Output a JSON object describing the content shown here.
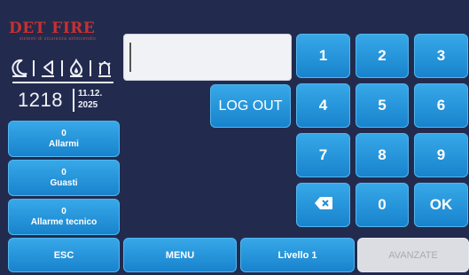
{
  "logo": {
    "brand": "DET FIRE",
    "tagline": "sistemi di sicurezza antincendio"
  },
  "status_icons": [
    "moon-icon",
    "speaker-icon",
    "flame-icon",
    "siren-icon"
  ],
  "clock": {
    "time": "1218",
    "date_line1": "11.12.",
    "date_line2": "2025"
  },
  "counters": [
    {
      "count": "0",
      "label": "Allarmi"
    },
    {
      "count": "0",
      "label": "Guasti"
    },
    {
      "count": "0",
      "label": "Allarme tecnico"
    }
  ],
  "password": {
    "value": ""
  },
  "logout_label": "LOG OUT",
  "keypad": {
    "k1": "1",
    "k2": "2",
    "k3": "3",
    "k4": "4",
    "k5": "5",
    "k6": "6",
    "k7": "7",
    "k8": "8",
    "k9": "9",
    "k0": "0",
    "ok": "OK",
    "backspace_icon": "backspace-icon"
  },
  "bottom_bar": {
    "esc": "ESC",
    "menu": "MENU",
    "level": "Livello 1",
    "advanced": "AVANZATE"
  },
  "colors": {
    "background": "#222b4e",
    "button": "#1f8ed6",
    "disabled": "#dcdde2",
    "brand": "#c83030"
  }
}
